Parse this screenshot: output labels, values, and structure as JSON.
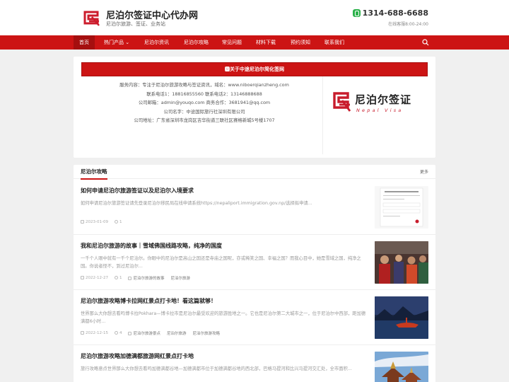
{
  "header": {
    "site_title": "尼泊尔签证中心代办网",
    "site_sub": "尼泊尔旅游、签证、业务站",
    "phone": "1314-688-6688",
    "hours": "在线客服8:00-24:00"
  },
  "nav": {
    "items": [
      "首页",
      "热门产品 ⌄",
      "尼泊尔资讯",
      "尼泊尔攻略",
      "常见问题",
      "材料下载",
      "预约须知",
      "联系我们"
    ]
  },
  "about": {
    "heading": "🅼关于中途尼泊尔简化签网",
    "lines": [
      "服务内容：专注于尼泊尔旅游攻略与签证资讯，域名：www.niboerqianzheng.com",
      "联系电话1：18816855560 联系电话2：13146888688",
      "公司邮箱：admin@youqo.com 商务合作：3681941@qq.com",
      "公司名字：中途国际旅行社深圳有限公司",
      "公司地址：广东省深圳市龙岗区吉华街道三联社区赛格新城5号楼1707"
    ],
    "brand_cn": "尼泊尔签证",
    "brand_en": "Nepal Visa"
  },
  "section": {
    "title": "尼泊尔攻略",
    "more": "更多"
  },
  "articles": [
    {
      "title": "如何申请尼泊尔旅游签证以及尼泊尔入境要求",
      "excerpt": "如何申请尼泊尔旅游签证请先登录尼泊尔移民局在线申请系统https://nepaliport.immigration.gov.np/选择拟申请...",
      "date": "2023-01-09",
      "views": "1",
      "tags": []
    },
    {
      "title": "我和尼泊尔旅游的故事｜雪域佛国线路攻略，纯净的国度",
      "excerpt": "一千个人眼中就有一千个尼泊尔。你眼中的尼泊尔是高山之国还是寺庙之国呢，亦或稀笑之国、幸福之国？而我心目中，她是雪域之国，纯净之国。你说者怪不，到过尼泊尔...",
      "date": "2022-12-27",
      "views": "1",
      "tags": [
        "尼泊尔旅游的故事",
        "尼泊尔旅游"
      ]
    },
    {
      "title": "尼泊尔旅游攻略博卡拉网红景点打卡地！看这篇就够！",
      "excerpt": "世界那么大你想去看吗博卡拉Pokhara—博卡拉市是尼泊尔最受欢迎的旅游胜地之一。它也是尼泊尔第二大城市之一，位于尼泊尔中西部，距加德满都6小时...",
      "date": "2022-12-15",
      "views": "4",
      "tags": [
        "尼泊尔旅游景点",
        "尼泊尔旅游",
        "尼泊尔旅游攻略"
      ]
    },
    {
      "title": "尼泊尔旅游攻略加德满都旅游网红景点打卡地",
      "excerpt": "旅行攻略意点世界那么大你想去看吗加德满都谷地—加德满都市位于加德满都谷地的西北部，巴格马提河和比兴马提河交汇处，全市面积...",
      "date": "",
      "views": "",
      "tags": []
    }
  ],
  "colors": {
    "brand_red": "#cc1414",
    "nav_active": "#a50f0f",
    "phone_green": "#2bb14a"
  }
}
